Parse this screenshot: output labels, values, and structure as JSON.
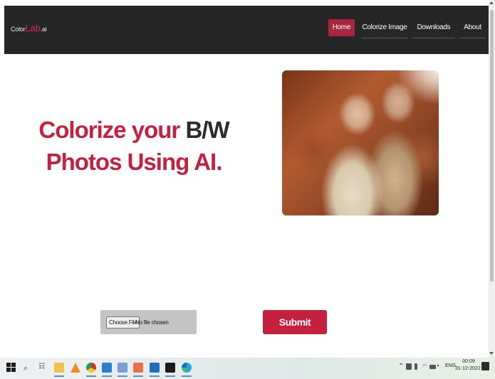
{
  "brand": {
    "prefix": "Color",
    "accent": "Lab",
    "suffix": ".ai"
  },
  "nav": {
    "home": "Home",
    "colorize": "Colorize Image",
    "downloads": "Downloads",
    "about": "About"
  },
  "hero": {
    "line1_red": "Colorize your",
    "line1_dark": "B/W",
    "line2": "Photos Using AI."
  },
  "form": {
    "choose_file_label": "Choose File",
    "file_status": "No file chosen",
    "submit_label": "Submit"
  },
  "taskbar": {
    "tray_language": "ENG",
    "time": "00:09",
    "date": "31-12-2022"
  },
  "colors": {
    "brand_red": "#c5213e",
    "nav_bg": "#262626",
    "active_nav": "#a8273e"
  }
}
